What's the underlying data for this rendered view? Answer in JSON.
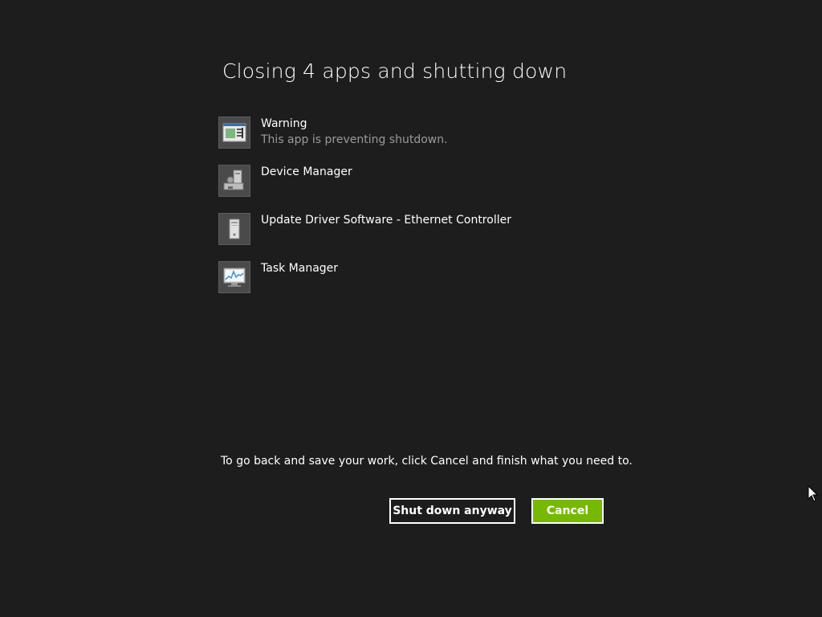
{
  "dialog": {
    "title": "Closing 4 apps and shutting down",
    "apps": [
      {
        "name": "Warning",
        "status": "This app is preventing shutdown.",
        "icon": "warning-window-icon"
      },
      {
        "name": "Device Manager",
        "status": "",
        "icon": "device-manager-icon"
      },
      {
        "name": "Update Driver Software - Ethernet Controller",
        "status": "",
        "icon": "computer-tower-icon"
      },
      {
        "name": "Task Manager",
        "status": "",
        "icon": "task-manager-icon"
      }
    ],
    "instruction": "To go back and save your work, click Cancel and finish what you need to.",
    "shutdown_label": "Shut down anyway",
    "cancel_label": "Cancel"
  },
  "colors": {
    "background": "#1d1d1d",
    "accent_green": "#76b900",
    "secondary_text": "#9a9a9a"
  }
}
